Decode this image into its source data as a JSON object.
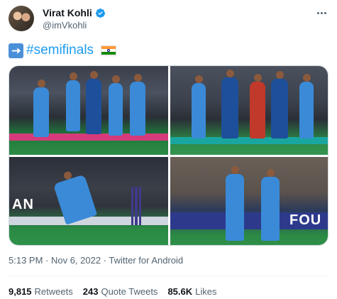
{
  "author": {
    "display_name": "Virat Kohli",
    "handle": "@imVkohli",
    "verified": true
  },
  "tweet": {
    "hashtag": "#semifinals",
    "emojis": [
      "right-arrow-emoji",
      "india-flag-emoji"
    ]
  },
  "media": {
    "photo_count": 4,
    "photos": [
      {
        "description_icon": "team-celebration-photo"
      },
      {
        "description_icon": "team-huddle-photo"
      },
      {
        "description_icon": "batsman-shot-photo"
      },
      {
        "description_icon": "batsmen-walking-photo"
      }
    ],
    "visible_text": {
      "photo3_board": "AN",
      "photo4_board": "FOU"
    }
  },
  "meta": {
    "timestamp": "5:13 PM · Nov 6, 2022 · Twitter for Android"
  },
  "stats": {
    "retweets_count": "9,815",
    "retweets_label": "Retweets",
    "quotes_count": "243",
    "quotes_label": "Quote Tweets",
    "likes_count": "85.6K",
    "likes_label": "Likes"
  },
  "colors": {
    "accent": "#1d9bf0",
    "text_primary": "#0f1419",
    "text_secondary": "#536471",
    "border": "#cfd9de"
  }
}
